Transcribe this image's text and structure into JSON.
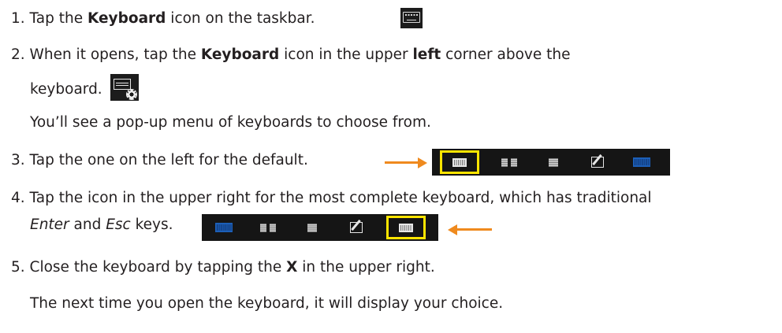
{
  "steps": [
    {
      "num": "1.",
      "pre": "Tap the ",
      "bold": "Keyboard",
      "post": " icon on the taskbar."
    },
    {
      "num": "2.",
      "pre": "When it opens, tap the ",
      "bold": "Keyboard",
      "mid": " icon in the upper ",
      "bold2": "left",
      "post": " corner above the",
      "line2": "keyboard.",
      "note": "You’ll see a pop-up menu of keyboards to choose from."
    },
    {
      "num": "3.",
      "text": "Tap the one on the left for the default."
    },
    {
      "num": "4.",
      "text": "Tap the icon in the upper right for the most complete keyboard, which has traditional",
      "italic1": "Enter",
      "and": " and ",
      "italic2": "Esc",
      "post": " keys."
    },
    {
      "num": "5.",
      "pre": "Close the keyboard by tapping the ",
      "bold": "X",
      "post": " in the upper right.",
      "note": "The next time you open the keyboard, it will display your choice."
    }
  ],
  "icons": {
    "taskbar": "keyboard-icon",
    "settings": "keyboard-gear-icon",
    "strip_default": [
      "keyboard-default-icon",
      "keyboard-split-icon",
      "keyboard-small-icon",
      "handwriting-icon",
      "keyboard-full-blue-icon"
    ],
    "strip_full": [
      "keyboard-default-blue-icon",
      "keyboard-split-icon",
      "keyboard-small-icon",
      "handwriting-icon",
      "keyboard-full-icon"
    ]
  },
  "colors": {
    "arrow": "#ef8a1e",
    "highlight": "#ffe500",
    "icon_bg": "#1c1c1c",
    "blue_keyboard": "#1c5fb8"
  }
}
